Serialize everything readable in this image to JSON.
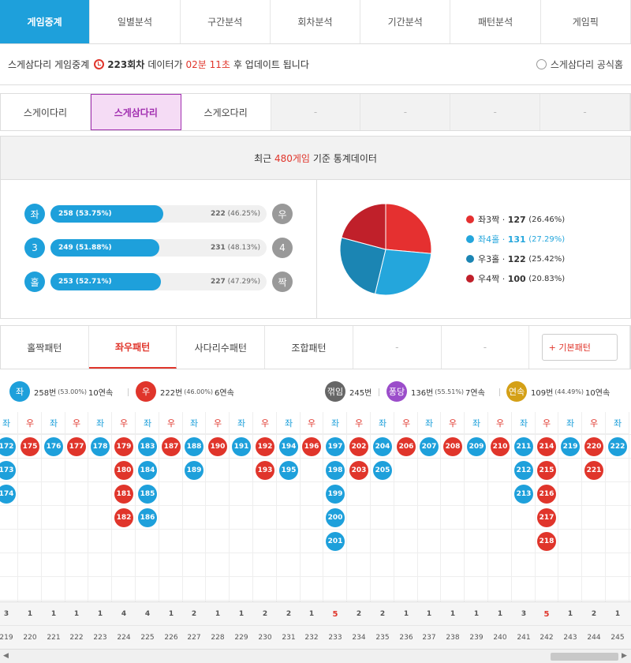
{
  "nav": {
    "tabs": [
      "게임중계",
      "일별분석",
      "구간분석",
      "회차분석",
      "기간분석",
      "패턴분석",
      "게임픽"
    ]
  },
  "info": {
    "label": "스게삼다리 게임중계",
    "round": "223회차",
    "text1": "데이터가",
    "time": "02분 11초",
    "text2": "후 업데이트 됩니다",
    "official": "스게삼다리 공식홈"
  },
  "game_tabs": [
    "스게이다리",
    "스게삼다리",
    "스게오다리",
    "-",
    "-",
    "-",
    "-"
  ],
  "stats": {
    "header_pre": "최근",
    "header_count": "480게임",
    "header_post": "기준 통계데이터",
    "rows": [
      {
        "left": "좌",
        "right": "우",
        "left_val": "258 (53.75%)",
        "right_count": "222",
        "right_pct": "(46.25%)",
        "ratio": 0.5375
      },
      {
        "left": "3",
        "right": "4",
        "left_val": "249 (51.88%)",
        "right_count": "231",
        "right_pct": "(48.13%)",
        "ratio": 0.5188
      },
      {
        "left": "홀",
        "right": "짝",
        "left_val": "253 (52.71%)",
        "right_count": "227",
        "right_pct": "(47.29%)",
        "ratio": 0.5271
      }
    ],
    "legend": [
      {
        "label": "좌3짝",
        "count": "127",
        "pct": "(26.46%)",
        "color": "#e53030"
      },
      {
        "label": "좌4홀",
        "count": "131",
        "pct": "(27.29%)",
        "color": "#24a6dc"
      },
      {
        "label": "우3홀",
        "count": "122",
        "pct": "(25.42%)",
        "color": "#1b85b3"
      },
      {
        "label": "우4짝",
        "count": "100",
        "pct": "(20.83%)",
        "color": "#c0202a"
      }
    ]
  },
  "chart_data": {
    "type": "pie",
    "categories": [
      "좌3짝",
      "좌4홀",
      "우3홀",
      "우4짝"
    ],
    "values": [
      127,
      131,
      122,
      100
    ],
    "colors": [
      "#e53030",
      "#24a6dc",
      "#1b85b3",
      "#c0202a"
    ]
  },
  "pattern_tabs": [
    "홀짝패턴",
    "좌우패턴",
    "사다리수패턴",
    "조합패턴",
    "-",
    "-"
  ],
  "basic_pattern": "+ 기본패턴",
  "summary": {
    "left": {
      "label": "좌",
      "count": "258번",
      "pct": "(53.00%)",
      "streak": "10연속",
      "color": "#1ea0db"
    },
    "right": {
      "label": "우",
      "count": "222번",
      "pct": "(46.00%)",
      "streak": "6연속",
      "color": "#e0352b"
    },
    "break": {
      "label": "꺾임",
      "count": "245번",
      "color": "#666666"
    },
    "pong": {
      "label": "퐁당",
      "count": "136번",
      "pct": "(55.51%)",
      "streak": "7연속",
      "color": "#9b4dca"
    },
    "cont": {
      "label": "연속",
      "count": "109번",
      "pct": "(44.49%)",
      "streak": "10연속",
      "color": "#d4a017"
    }
  },
  "grid": {
    "columns": [
      {
        "side": "좌",
        "cls": "L",
        "balls": [
          "172",
          "173",
          "174"
        ]
      },
      {
        "side": "우",
        "cls": "R",
        "balls": [
          "175"
        ]
      },
      {
        "side": "좌",
        "cls": "L",
        "balls": [
          "176"
        ]
      },
      {
        "side": "우",
        "cls": "R",
        "balls": [
          "177"
        ]
      },
      {
        "side": "좌",
        "cls": "L",
        "balls": [
          "178"
        ]
      },
      {
        "side": "우",
        "cls": "R",
        "balls": [
          "179",
          "180",
          "181",
          "182"
        ]
      },
      {
        "side": "좌",
        "cls": "L",
        "balls": [
          "183",
          "184",
          "185",
          "186"
        ]
      },
      {
        "side": "우",
        "cls": "R",
        "balls": [
          "187"
        ]
      },
      {
        "side": "좌",
        "cls": "L",
        "balls": [
          "188",
          "189"
        ]
      },
      {
        "side": "우",
        "cls": "R",
        "balls": [
          "190"
        ]
      },
      {
        "side": "좌",
        "cls": "L",
        "balls": [
          "191"
        ]
      },
      {
        "side": "우",
        "cls": "R",
        "balls": [
          "192",
          "193"
        ]
      },
      {
        "side": "좌",
        "cls": "L",
        "balls": [
          "194",
          "195"
        ]
      },
      {
        "side": "우",
        "cls": "R",
        "balls": [
          "196"
        ]
      },
      {
        "side": "좌",
        "cls": "L",
        "balls": [
          "197",
          "198",
          "199",
          "200",
          "201"
        ]
      },
      {
        "side": "우",
        "cls": "R",
        "balls": [
          "202",
          "203"
        ]
      },
      {
        "side": "좌",
        "cls": "L",
        "balls": [
          "204",
          "205"
        ]
      },
      {
        "side": "우",
        "cls": "R",
        "balls": [
          "206"
        ]
      },
      {
        "side": "좌",
        "cls": "L",
        "balls": [
          "207"
        ]
      },
      {
        "side": "우",
        "cls": "R",
        "balls": [
          "208"
        ]
      },
      {
        "side": "좌",
        "cls": "L",
        "balls": [
          "209"
        ]
      },
      {
        "side": "우",
        "cls": "R",
        "balls": [
          "210"
        ]
      },
      {
        "side": "좌",
        "cls": "L",
        "balls": [
          "211",
          "212",
          "213"
        ]
      },
      {
        "side": "우",
        "cls": "R",
        "balls": [
          "214",
          "215",
          "216",
          "217",
          "218"
        ]
      },
      {
        "side": "좌",
        "cls": "L",
        "balls": [
          "219"
        ]
      },
      {
        "side": "우",
        "cls": "R",
        "balls": [
          "220",
          "221"
        ]
      },
      {
        "side": "좌",
        "cls": "L",
        "balls": [
          "222"
        ]
      }
    ],
    "counts": [
      "3",
      "1",
      "1",
      "1",
      "1",
      "4",
      "4",
      "1",
      "2",
      "1",
      "1",
      "2",
      "2",
      "1",
      "5",
      "2",
      "2",
      "1",
      "1",
      "1",
      "1",
      "1",
      "3",
      "5",
      "1",
      "2",
      "1"
    ],
    "rounds": [
      "219",
      "220",
      "221",
      "222",
      "223",
      "224",
      "225",
      "226",
      "227",
      "228",
      "229",
      "230",
      "231",
      "232",
      "233",
      "234",
      "235",
      "236",
      "237",
      "238",
      "239",
      "240",
      "241",
      "242",
      "243",
      "244",
      "245"
    ]
  }
}
